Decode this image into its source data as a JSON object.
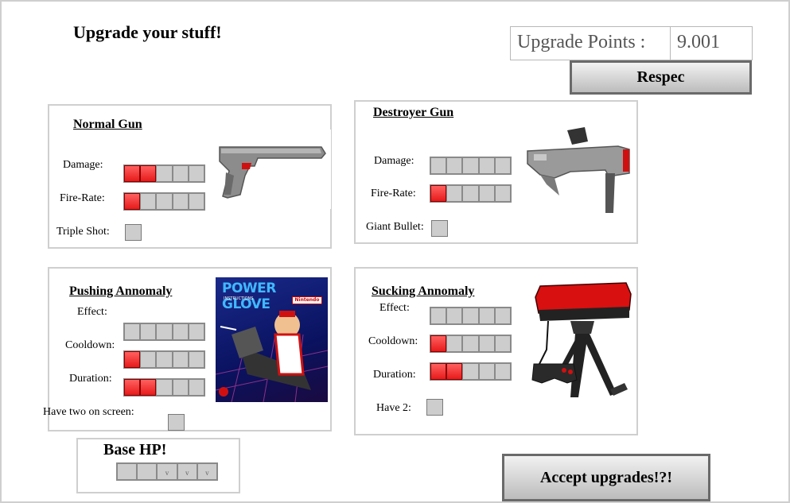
{
  "header": {
    "title": "Upgrade your stuff!"
  },
  "points": {
    "label": "Upgrade Points :",
    "value": "9.001"
  },
  "buttons": {
    "respec": "Respec",
    "accept": "Accept upgrades!?!"
  },
  "colors": {
    "filled_segment": "#e81a1a",
    "empty_segment": "#cdcdcd",
    "panel_border": "#cfcfcf"
  },
  "panels": {
    "normal_gun": {
      "title": "Normal Gun",
      "image_icon": "zapper-light-gun-icon",
      "damage": {
        "label": "Damage:",
        "level": 2,
        "max": 5
      },
      "fire_rate": {
        "label": "Fire-Rate:",
        "level": 1,
        "max": 5
      },
      "toggle": {
        "label": "Triple Shot:",
        "checked": false
      }
    },
    "destroyer_gun": {
      "title": "Destroyer Gun",
      "image_icon": "super-scope-icon",
      "damage": {
        "label": "Damage:",
        "level": 0,
        "max": 5
      },
      "fire_rate": {
        "label": "Fire-Rate:",
        "level": 1,
        "max": 5
      },
      "toggle": {
        "label": "Giant Bullet:",
        "checked": false
      }
    },
    "pushing": {
      "title": "Pushing Annomaly",
      "image_icon": "power-glove-box-icon",
      "image_text": {
        "logo": "POWER GLOVE",
        "sub": "INSTRUCTIONS",
        "brand": "Nintendo"
      },
      "effect": {
        "label": "Effect:",
        "level": 0,
        "max": 5
      },
      "cooldown": {
        "label": "Cooldown:",
        "level": 1,
        "max": 5
      },
      "duration": {
        "label": "Duration:",
        "level": 2,
        "max": 5
      },
      "toggle": {
        "label": "Have two on screen:",
        "checked": false
      }
    },
    "sucking": {
      "title": "Sucking Annomaly",
      "image_icon": "virtual-boy-icon",
      "effect": {
        "label": "Effect:",
        "level": 0,
        "max": 5
      },
      "cooldown": {
        "label": "Cooldown:",
        "level": 1,
        "max": 5
      },
      "duration": {
        "label": "Duration:",
        "level": 2,
        "max": 5
      },
      "toggle": {
        "label": "Have 2:",
        "checked": false
      }
    }
  },
  "base_hp": {
    "title": "Base HP!",
    "level": 0,
    "max": 5,
    "marks": [
      "",
      "",
      "v",
      "v",
      "v"
    ]
  }
}
